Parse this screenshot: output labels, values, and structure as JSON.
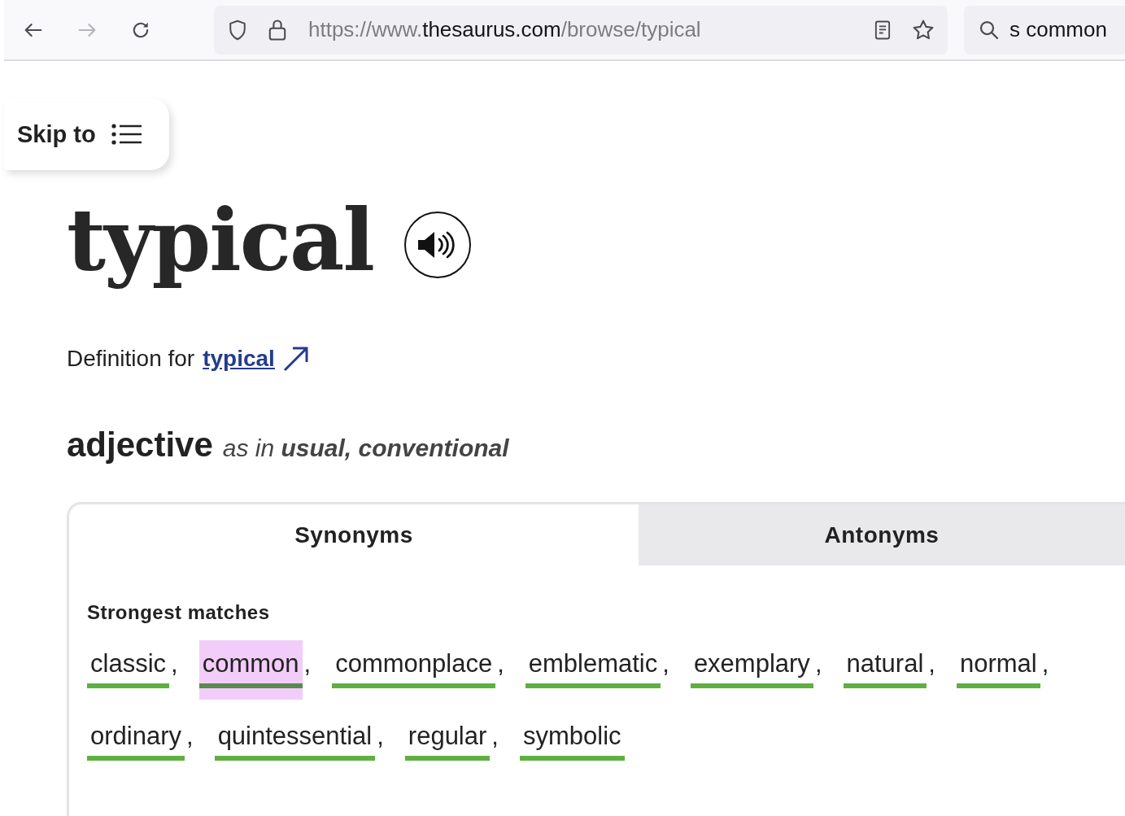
{
  "browser": {
    "url": {
      "prefix": "https://www.",
      "domain": "thesaurus.com",
      "path": "/browse/typical"
    },
    "search": {
      "value": "s common"
    },
    "forward_disabled": true
  },
  "skip_to": {
    "label": "Skip to"
  },
  "headword": "typical",
  "definition": {
    "label": "Definition for",
    "link": "typical"
  },
  "sense": {
    "part_of_speech": "adjective",
    "gloss": "as in **usual, conventional**"
  },
  "tabs": [
    {
      "label": "Synonyms",
      "selected": true
    },
    {
      "label": "Antonyms",
      "selected": false
    }
  ],
  "matches": {
    "heading": "Strongest matches",
    "words": [
      {
        "word": "classic",
        "separator": ",",
        "selected": false
      },
      {
        "word": "common",
        "separator": ",",
        "selected": true
      },
      {
        "word": "commonplace",
        "separator": ",",
        "selected": false
      },
      {
        "word": "emblematic",
        "separator": ",",
        "selected": false
      },
      {
        "word": "exemplary",
        "separator": ",",
        "selected": false
      },
      {
        "word": "natural",
        "separator": ",",
        "selected": false
      },
      {
        "word": "normal",
        "separator": ",",
        "selected": false
      },
      {
        "word": "ordinary",
        "separator": ",",
        "selected": false
      },
      {
        "word": "quintessential",
        "separator": ",",
        "selected": false
      },
      {
        "word": "regular",
        "separator": ",",
        "selected": false
      },
      {
        "word": "symbolic",
        "selected": false
      }
    ]
  }
}
